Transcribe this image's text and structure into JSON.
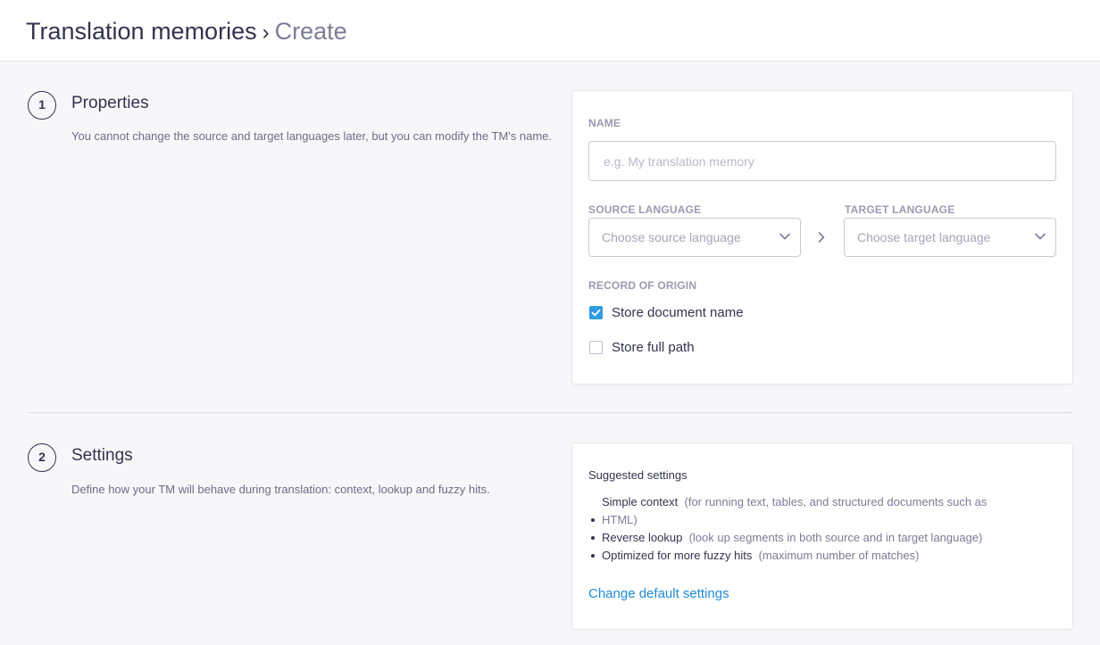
{
  "breadcrumb": {
    "root": "Translation memories",
    "separator": "›",
    "current": "Create"
  },
  "properties": {
    "step": "1",
    "title": "Properties",
    "description": "You cannot change the source and target languages later, but you can modify the TM's name.",
    "name_label": "NAME",
    "name_placeholder": "e.g. My translation memory",
    "name_value": "",
    "source_label": "SOURCE LANGUAGE",
    "source_placeholder": "Choose source language",
    "target_label": "TARGET LANGUAGE",
    "target_placeholder": "Choose target language",
    "origin_label": "RECORD OF ORIGIN",
    "store_document_name": {
      "label": "Store document name",
      "checked": true
    },
    "store_full_path": {
      "label": "Store full path",
      "checked": false
    }
  },
  "settings": {
    "step": "2",
    "title": "Settings",
    "description": "Define how your TM will behave during translation: context, lookup and fuzzy hits.",
    "suggested_title": "Suggested settings",
    "items": [
      {
        "name": "Simple context",
        "hint_line1": "(for running text, tables, and structured documents such as",
        "hint_line2": "HTML)"
      },
      {
        "name": "Reverse lookup",
        "hint": "(look up segments in both source and in target language)"
      },
      {
        "name": "Optimized for more fuzzy hits",
        "hint": "(maximum number of matches)"
      }
    ],
    "change_link": "Change default settings"
  },
  "colors": {
    "accent": "#2f9be0",
    "link": "#1f8ad6",
    "text": "#33334d",
    "muted": "#7c7c96",
    "background": "#f7f7fa"
  },
  "icons": {
    "chevron": "chevron-down-icon",
    "arrow": "chevron-right-icon",
    "check": "check-icon"
  }
}
